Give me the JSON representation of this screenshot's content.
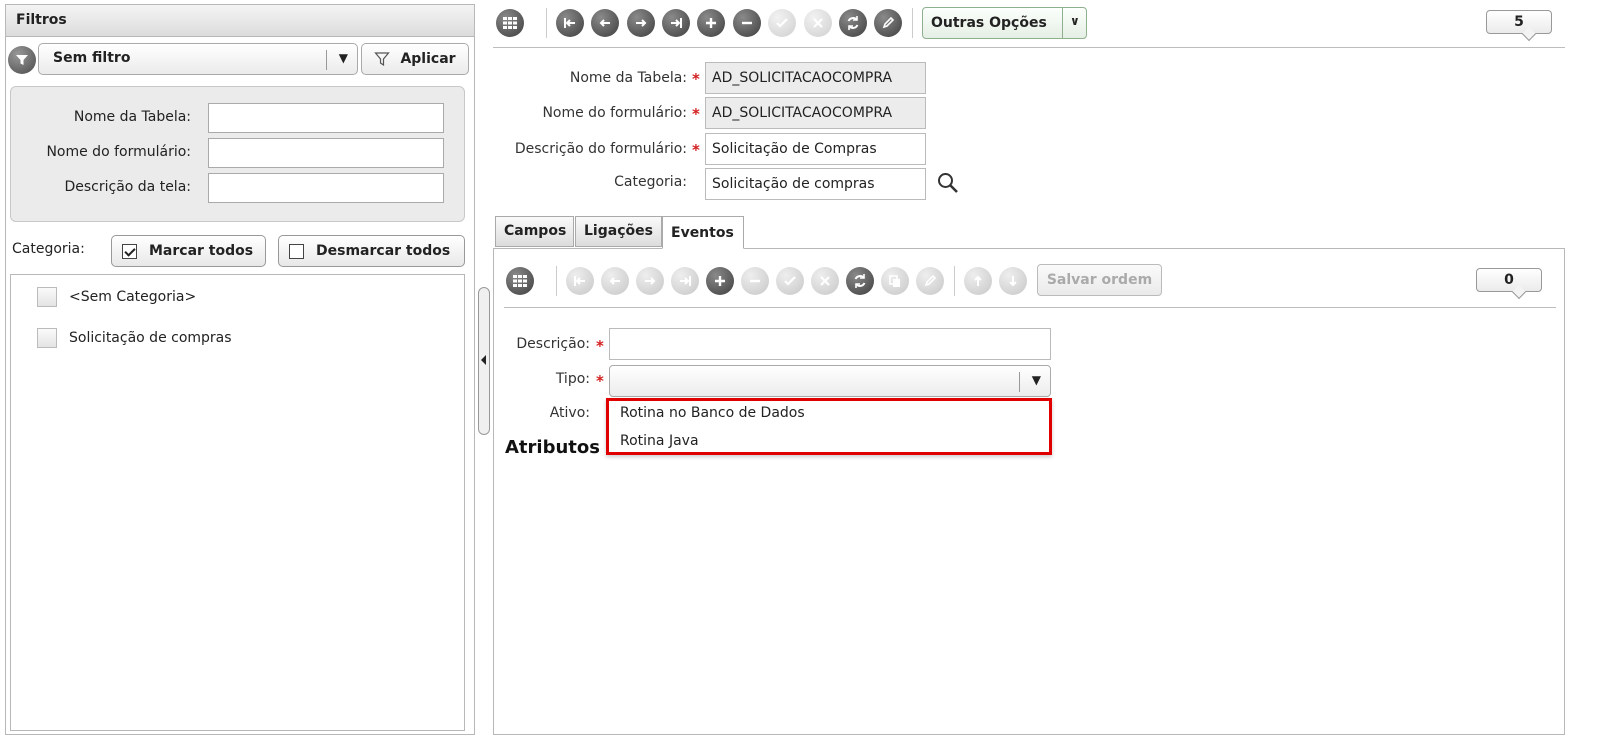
{
  "left": {
    "header": "Filtros",
    "filter_select": "Sem filtro",
    "apply_label": "Aplicar",
    "fields": [
      {
        "label": "Nome da Tabela:",
        "value": ""
      },
      {
        "label": "Nome do formulário:",
        "value": ""
      },
      {
        "label": "Descrição da tela:",
        "value": ""
      }
    ],
    "category_label": "Categoria:",
    "mark_all": "Marcar todos",
    "unmark_all": "Desmarcar todos",
    "categories": [
      "<Sem Categoria>",
      "Solicitação de compras"
    ]
  },
  "toolbar": {
    "other_options": "Outras Opções",
    "record_count": "5"
  },
  "form": {
    "table_name_label": "Nome da Tabela:",
    "table_name": "AD_SOLICITACAOCOMPRA",
    "form_name_label": "Nome do formulário:",
    "form_name": "AD_SOLICITACAOCOMPRA",
    "form_desc_label": "Descrição do formulário:",
    "form_desc": "Solicitação de Compras",
    "category_label": "Categoria:",
    "category": "Solicitação de compras"
  },
  "tabs": [
    "Campos",
    "Ligações",
    "Eventos"
  ],
  "events": {
    "save_order": "Salvar ordem",
    "count": "0",
    "desc_label": "Descrição:",
    "tipo_label": "Tipo:",
    "ativo_label": "Ativo:",
    "attributes_heading": "Atributos",
    "tipo_options": [
      "Rotina no Banco de Dados",
      "Rotina Java"
    ]
  },
  "colors": {
    "required": "#d21f1f",
    "highlight": "#e00000"
  }
}
